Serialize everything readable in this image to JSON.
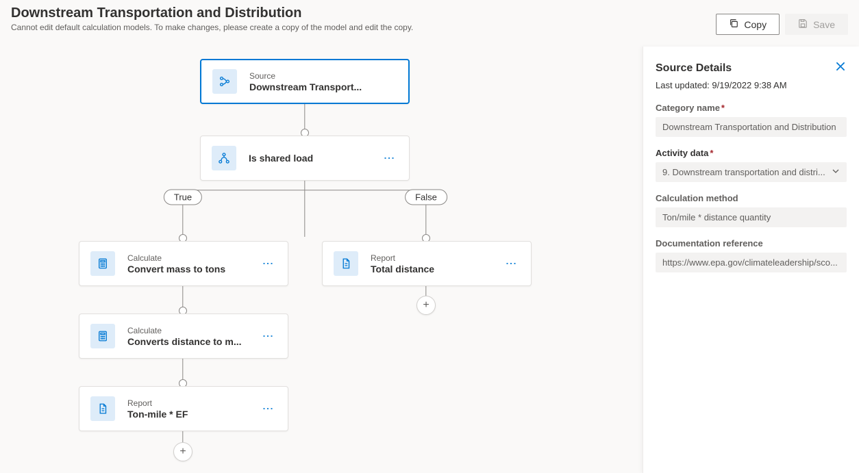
{
  "header": {
    "title": "Downstream Transportation and Distribution",
    "subtitle": "Cannot edit default calculation models. To make changes, please create a copy of the model and edit the copy.",
    "copy_label": "Copy",
    "save_label": "Save"
  },
  "nodes": {
    "source": {
      "type": "Source",
      "value": "Downstream Transport..."
    },
    "condition": {
      "type": "",
      "value": "Is shared load"
    },
    "true_label": "True",
    "false_label": "False",
    "calc1": {
      "type": "Calculate",
      "value": "Convert mass to tons"
    },
    "calc2": {
      "type": "Calculate",
      "value": "Converts distance to m..."
    },
    "report1": {
      "type": "Report",
      "value": "Ton-mile * EF"
    },
    "report2": {
      "type": "Report",
      "value": "Total distance"
    }
  },
  "details": {
    "title": "Source Details",
    "updated": "Last updated: 9/19/2022 9:38 AM",
    "category_label": "Category name",
    "category_value": "Downstream Transportation and Distribution",
    "activity_label": "Activity data",
    "activity_value": "9. Downstream transportation and distri...",
    "method_label": "Calculation method",
    "method_value": "Ton/mile * distance quantity",
    "doc_label": "Documentation reference",
    "doc_value": "https://www.epa.gov/climateleadership/sco..."
  }
}
